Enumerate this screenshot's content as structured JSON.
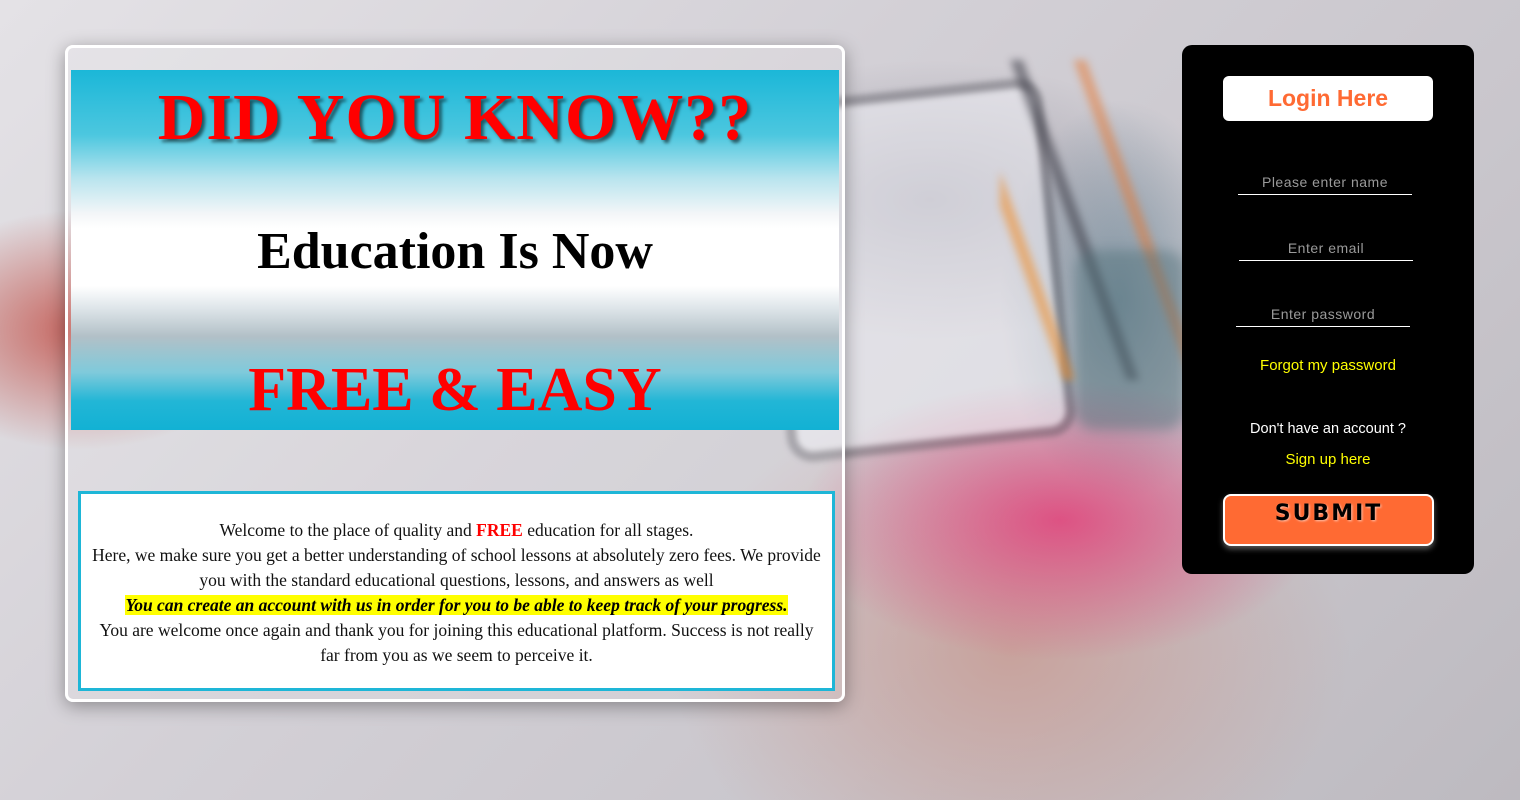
{
  "banner": {
    "title": "DID YOU KNOW??",
    "subtitle": "Education Is Now",
    "tagline": "FREE & EASY"
  },
  "welcome": {
    "line1_a": "Welcome to the place of quality and ",
    "line1_free": "FREE",
    "line1_b": " education for all stages.",
    "line2": "Here, we make sure you get a better understanding of school lessons at absolutely zero fees. We provide you with the standard educational questions, lessons, and answers as well",
    "highlight": "You can create an account with us in order for you to be able to keep track of your progress.",
    "line4": "You are welcome once again and thank you for joining this educational platform. Success is not really far from you as we seem to perceive it."
  },
  "login": {
    "title": "Login Here",
    "name_placeholder": "Please enter name",
    "email_placeholder": "Enter email",
    "password_placeholder": "Enter password",
    "forgot": "Forgot my password",
    "no_account": "Don't have an account ?",
    "signup": "Sign up here",
    "submit": "SUBMIT"
  },
  "colors": {
    "accent": "#ff6a33",
    "link": "#ffff00",
    "banner_cyan": "#1bb7d8",
    "headline_red": "#ff0000"
  }
}
